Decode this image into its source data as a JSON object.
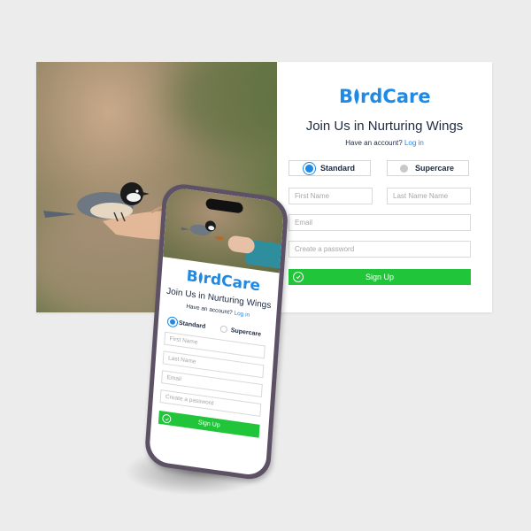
{
  "brand": {
    "name_prefix": "B",
    "name_rest": "rdCare",
    "accent": "#1e8ae6",
    "button_color": "#21c53a"
  },
  "desktop": {
    "title": "Join Us in Nurturing Wings",
    "have_account": "Have an account?",
    "login_link": "Log in",
    "options": [
      {
        "label": "Standard",
        "selected": true
      },
      {
        "label": "Supercare",
        "selected": false
      }
    ],
    "first_name_placeholder": "First Name",
    "last_name_placeholder": "Last Name Name",
    "email_placeholder": "Email",
    "password_placeholder": "Create a password",
    "signup_label": "Sign Up"
  },
  "mobile": {
    "title": "Join Us in Nurturing Wings",
    "have_account": "Have an account?",
    "login_link": "Log in",
    "options": [
      {
        "label": "Standard",
        "selected": true
      },
      {
        "label": "Supercare",
        "selected": false
      }
    ],
    "first_name_placeholder": "First Name",
    "last_name_placeholder": "Last Name",
    "email_placeholder": "Email",
    "password_placeholder": "Create a password",
    "signup_label": "Sign Up"
  }
}
